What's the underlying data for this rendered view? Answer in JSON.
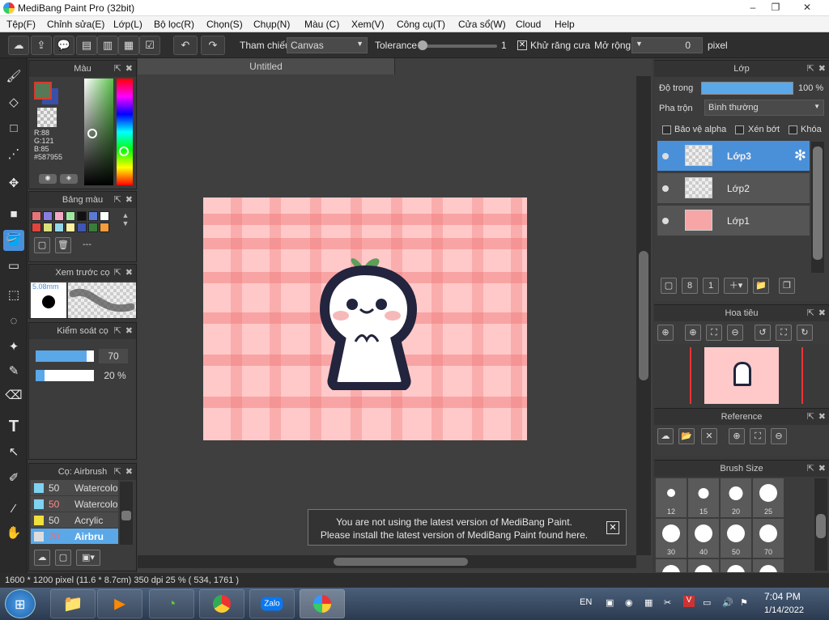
{
  "app": {
    "title": "MediBang Paint Pro (32bit)",
    "window_buttons": [
      "–",
      "❐",
      "✕"
    ]
  },
  "menu": [
    "Tệp(F)",
    "Chỉnh sửa(E)",
    "Lớp(L)",
    "Bộ lọc(R)",
    "Chọn(S)",
    "Chụp(N)",
    "Màu (C)",
    "Xem(V)",
    "Công cụ(T)",
    "Cửa sổ(W)",
    "Cloud",
    "Help"
  ],
  "toolbar": {
    "reference_label": "Tham chiếu",
    "reference_value": "Canvas",
    "tolerance_label": "Tolerance",
    "tolerance_value": "1",
    "antialias_label": "Khử răng cưa",
    "expand_label": "Mở rộng",
    "expand_value": "0",
    "expand_unit": "pixel"
  },
  "tools": [
    "brush-tool",
    "eraser-tool",
    "rectangle-tool",
    "dot-line-tool",
    "move-tool",
    "fill-shape-tool",
    "bucket-tool",
    "gradient-tool",
    "select-rect-tool",
    "lasso-tool",
    "magic-wand-tool",
    "select-pen-tool",
    "select-eraser-tool",
    "text-tool",
    "operation-tool",
    "divider-tool",
    "eyedropper-tool",
    "hand-tool"
  ],
  "color_panel": {
    "title": "Màu",
    "r": "R:88",
    "g": "G:121",
    "b": "B:85",
    "hex": "#587955",
    "primary_color": "#587955",
    "secondary_color": "#3a4fa8"
  },
  "palette_panel": {
    "title": "Bảng màu",
    "swatches": [
      "#e8737a",
      "#8a7de0",
      "#f2a8c4",
      "#a0e8a0",
      "#111111",
      "#5a7ad6",
      "#ffffff",
      "#e0443e",
      "#d9e07a",
      "#93d7e8",
      "#fff1a0",
      "#3f56b5",
      "#3a7d3a",
      "#f59c3c"
    ],
    "placeholder": "---"
  },
  "brush_preview": {
    "title": "Xem trước cọ",
    "size": "5.08mm"
  },
  "brush_control": {
    "title": "Kiểm soát cọ",
    "size_value": "70",
    "opacity_value": "20 %",
    "size_fraction": 0.88,
    "opacity_fraction": 0.15
  },
  "brush_list": {
    "title": "Cọ: Airbrush",
    "items": [
      {
        "size": "50",
        "name": "Watercolo",
        "color": "#7fd3f0"
      },
      {
        "size": "50",
        "name": "Watercolo",
        "color": "#7fd3f0"
      },
      {
        "size": "50",
        "name": "Acrylic",
        "color": "#f0e03c"
      },
      {
        "size": "70",
        "name": "Airbru",
        "color": "#dddddd"
      }
    ]
  },
  "document": {
    "tab": "Untitled"
  },
  "layer_panel": {
    "title": "Lớp",
    "opacity_label": "Độ trong",
    "opacity_value": "100 %",
    "blend_label": "Pha trộn",
    "blend_value": "Bình thường",
    "protect_alpha": "Bảo vệ alpha",
    "clipping": "Xén bớt",
    "lock": "Khóa",
    "layers": [
      "Lớp3",
      "Lớp2",
      "Lớp1"
    ]
  },
  "navigator": {
    "title": "Hoa tiêu"
  },
  "reference": {
    "title": "Reference"
  },
  "brush_size": {
    "title": "Brush Size",
    "sizes": [
      "12",
      "15",
      "20",
      "25",
      "30",
      "40",
      "50",
      "70",
      "",
      "",
      "",
      ""
    ]
  },
  "toast": {
    "line1": "You are not using the latest version of MediBang Paint.",
    "line2": "Please install the latest version of MediBang Paint found here."
  },
  "status": {
    "text": "1600 * 1200 pixel   (11.6 * 8.7cm)   350 dpi   25 %   ( 534, 1761 )"
  },
  "taskbar": {
    "lang": "EN",
    "time": "7:04 PM",
    "date": "1/14/2022",
    "zalo": "Zalo"
  }
}
